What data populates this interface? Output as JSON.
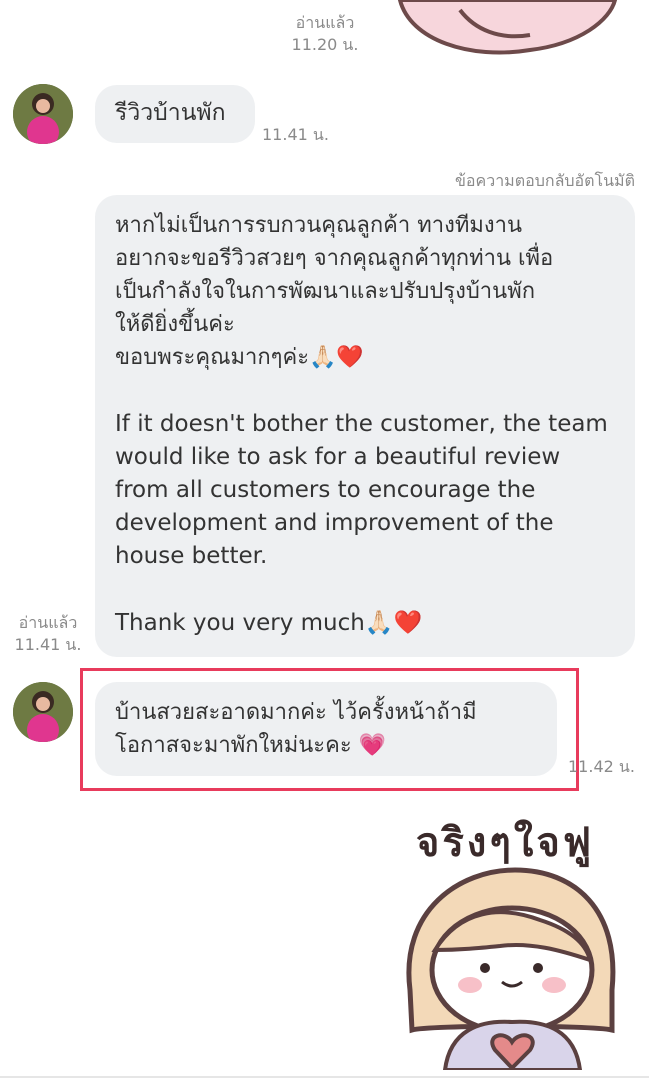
{
  "chat": {
    "top_read": {
      "label": "อ่านแล้ว",
      "time": "11.20 น."
    },
    "msg1": {
      "text": "รีวิวบ้านพัก",
      "time": "11.41 น."
    },
    "auto_reply_label": "ข้อความตอบกลับอัตโนมัติ",
    "msg2": {
      "thai": "หากไม่เป็นการรบกวนคุณลูกค้า ทางทีมงาน\nอยากจะขอรีวิวสวยๆ จากคุณลูกค้าทุกท่าน เพื่อ\nเป็นกำลังใจในการพัฒนาและปรับปรุงบ้านพัก\nให้ดียิ่งขึ้นค่ะ\nขอบพระคุณมากๆค่ะ🙏🏻❤️",
      "english": "If it doesn't bother the customer, the team\nwould like to ask for a beautiful review\nfrom all customers to encourage the\ndevelopment and improvement of the\nhouse better.",
      "thanks": "Thank you very much🙏🏻❤️",
      "read_label": "อ่านแล้ว",
      "time": "11.41 น."
    },
    "msg3": {
      "text": "บ้านสวยสะอาดมากค่ะ ไว้ครั้งหน้าถ้ามี\nโอกาสจะมาพักใหม่นะคะ 💗",
      "time": "11.42 น."
    },
    "sticker_caption": "จริงๆใจฟู"
  }
}
